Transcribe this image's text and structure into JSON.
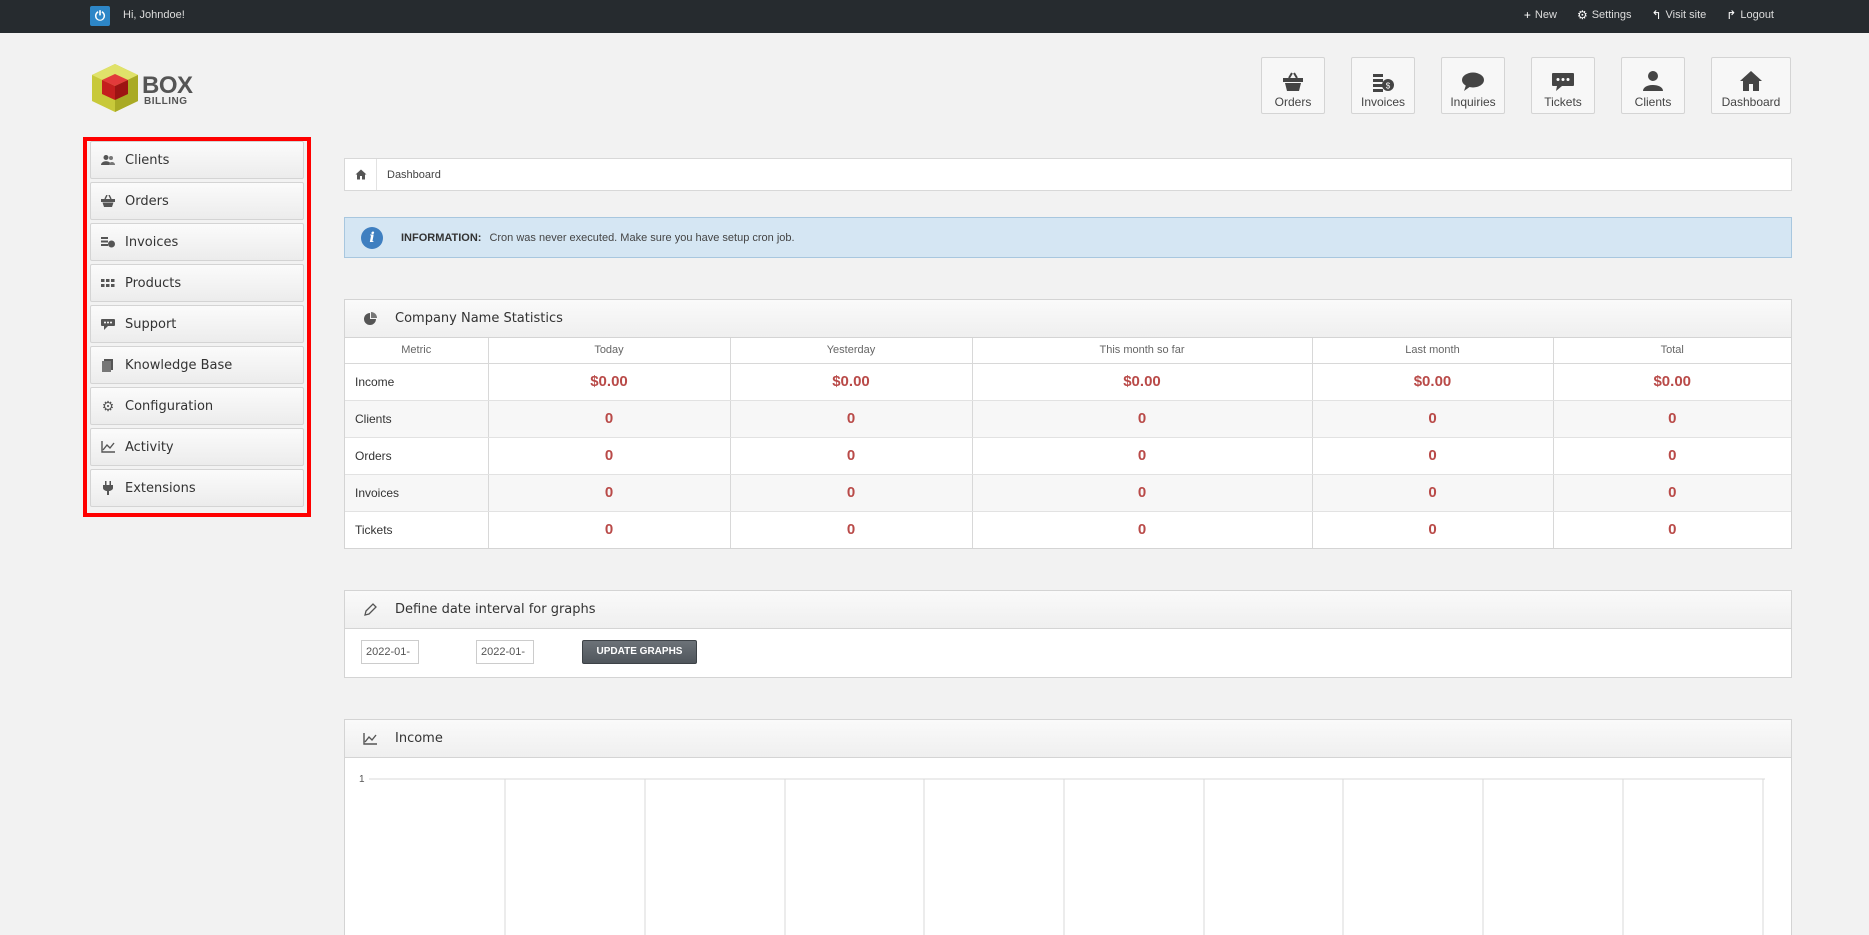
{
  "topbar": {
    "greeting": "Hi, Johndoe!",
    "links": [
      {
        "label": "New",
        "icon": "plus-icon"
      },
      {
        "label": "Settings",
        "icon": "gear-icon"
      },
      {
        "label": "Visit site",
        "icon": "reply-icon"
      },
      {
        "label": "Logout",
        "icon": "share-icon"
      }
    ]
  },
  "logo": {
    "line1": "BOX",
    "line2": "BILLING"
  },
  "shortcuts": [
    {
      "label": "Orders",
      "icon": "basket-icon"
    },
    {
      "label": "Invoices",
      "icon": "coins-icon"
    },
    {
      "label": "Inquiries",
      "icon": "speech-bubble-icon"
    },
    {
      "label": "Tickets",
      "icon": "ticket-bubble-icon"
    },
    {
      "label": "Clients",
      "icon": "user-icon"
    },
    {
      "label": "Dashboard",
      "icon": "home-icon"
    }
  ],
  "sidebar": {
    "items": [
      {
        "label": "Clients",
        "icon": "users-icon"
      },
      {
        "label": "Orders",
        "icon": "basket-icon"
      },
      {
        "label": "Invoices",
        "icon": "coins-icon"
      },
      {
        "label": "Products",
        "icon": "grid-icon"
      },
      {
        "label": "Support",
        "icon": "chat-icon"
      },
      {
        "label": "Knowledge Base",
        "icon": "book-icon"
      },
      {
        "label": "Configuration",
        "icon": "gear-icon"
      },
      {
        "label": "Activity",
        "icon": "chart-line-icon"
      },
      {
        "label": "Extensions",
        "icon": "plug-icon"
      }
    ]
  },
  "breadcrumb": {
    "current": "Dashboard"
  },
  "info": {
    "label": "INFORMATION:",
    "text": "Cron was never executed. Make sure you have setup cron job."
  },
  "stats": {
    "title": "Company Name Statistics",
    "columns": [
      "Metric",
      "Today",
      "Yesterday",
      "This month so far",
      "Last month",
      "Total"
    ],
    "rows": [
      {
        "metric": "Income",
        "values": [
          "$0.00",
          "$0.00",
          "$0.00",
          "$0.00",
          "$0.00"
        ]
      },
      {
        "metric": "Clients",
        "values": [
          "0",
          "0",
          "0",
          "0",
          "0"
        ]
      },
      {
        "metric": "Orders",
        "values": [
          "0",
          "0",
          "0",
          "0",
          "0"
        ]
      },
      {
        "metric": "Invoices",
        "values": [
          "0",
          "0",
          "0",
          "0",
          "0"
        ]
      },
      {
        "metric": "Tickets",
        "values": [
          "0",
          "0",
          "0",
          "0",
          "0"
        ]
      }
    ]
  },
  "date_interval": {
    "title": "Define date interval for graphs",
    "from_value": "2022-01-",
    "to_value": "2022-01-",
    "button": "UPDATE GRAPHS"
  },
  "income": {
    "title": "Income",
    "y_tick": "1"
  },
  "colors": {
    "accent_red": "#b94a48",
    "topbar": "#262b2f",
    "info_bg": "#d5e6f3",
    "highlight": "#ff0000"
  }
}
